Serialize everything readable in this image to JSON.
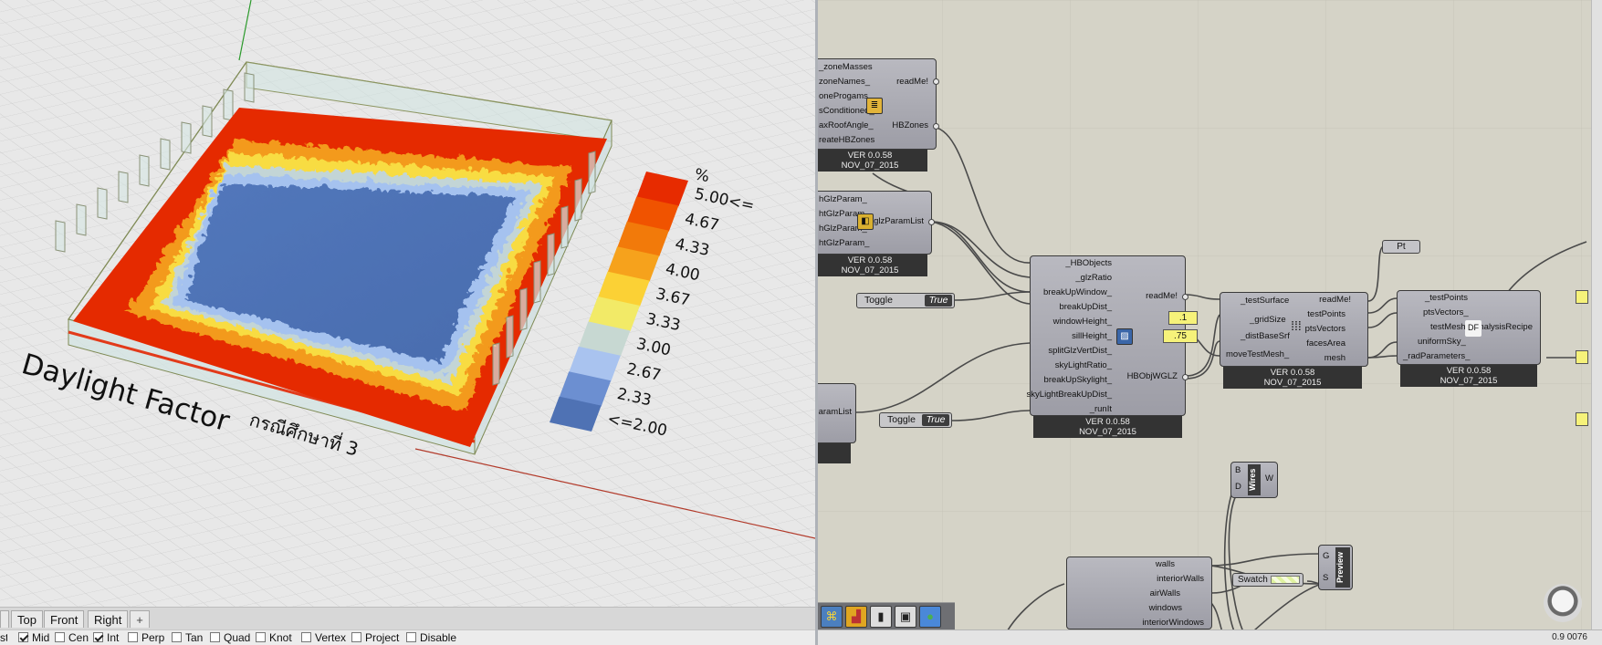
{
  "viewport": {
    "title_text": "Daylight Factor",
    "subtitle_thai": "กรณีศึกษาที่ 3",
    "legend": {
      "unit": "%",
      "labels": [
        "5.00<=",
        "4.67",
        "4.33",
        "4.00",
        "3.67",
        "3.33",
        "3.00",
        "2.67",
        "2.33",
        "<=2.00"
      ],
      "colors": [
        "#e72b00",
        "#f05300",
        "#f27a0a",
        "#f6a21c",
        "#fbd135",
        "#f2ea67",
        "#c7d8d2",
        "#a9c3ef",
        "#6c8fd1",
        "#4f72b4"
      ]
    },
    "tabs": [
      "Top",
      "Front",
      "Right"
    ],
    "add_tab_icon": "plus-icon",
    "osnaps": [
      {
        "label": "Mid",
        "checked": true
      },
      {
        "label": "Cen",
        "checked": false
      },
      {
        "label": "Int",
        "checked": true
      },
      {
        "label": "Perp",
        "checked": false
      },
      {
        "label": "Tan",
        "checked": false
      },
      {
        "label": "Quad",
        "checked": false
      },
      {
        "label": "Knot",
        "checked": false
      },
      {
        "label": "Vertex",
        "checked": false
      },
      {
        "label": "Project",
        "checked": false
      },
      {
        "label": "Disable",
        "checked": false
      }
    ]
  },
  "gh": {
    "zones": {
      "inputs": [
        "_zoneMasses",
        "zoneNames_",
        "oneProgams_",
        "sConditioned_",
        "axRoofAngle_",
        "reateHBZones"
      ],
      "outputs": [
        "readMe!",
        "HBZones"
      ],
      "version": "VER 0.0.58",
      "date": "NOV_07_2015"
    },
    "glz": {
      "inputs": [
        "hGlzParam_",
        "htGlzParam_",
        "hGlzParam_",
        "htGlzParam_"
      ],
      "output": "glzParamList",
      "version": "VER 0.0.58",
      "date": "NOV_07_2015"
    },
    "glz_partial": {
      "label": "aramList"
    },
    "hb": {
      "inputs": [
        "_HBObjects",
        "_glzRatio",
        "breakUpWindow_",
        "breakUpDist_",
        "windowHeight_",
        "sillHeight_",
        "splitGlzVertDist_",
        "skyLightRatio_",
        "breakUpSkylight_",
        "skyLightBreakUpDist_",
        "_runIt"
      ],
      "outputs": [
        "readMe!",
        "HBObjWGLZ"
      ],
      "version": "VER 0.0.58",
      "date": "NOV_07_2015"
    },
    "toggle1": {
      "label": "Toggle",
      "value": "True"
    },
    "toggle2": {
      "label": "Toggle",
      "value": "True"
    },
    "num1": ".1",
    "num2": ".75",
    "grid": {
      "inputs": [
        "_testSurface",
        "_gridSize",
        "_distBaseSrf",
        "moveTestMesh_"
      ],
      "outputs": [
        "readMe!",
        "testPoints",
        "ptsVectors",
        "facesArea",
        "mesh"
      ],
      "version": "VER 0.0.58",
      "date": "NOV_07_2015"
    },
    "pt": "Pt",
    "recipe": {
      "inputs": [
        "_testPoints",
        "ptsVectors_",
        "testMesh_",
        "uniformSky_",
        "_radParameters_"
      ],
      "output": "analysisRecipe",
      "version": "VER 0.0.58",
      "date": "NOV_07_2015"
    },
    "wires": {
      "in1": "B",
      "in2": "D",
      "label": "Wires",
      "out": "W"
    },
    "swatch": {
      "label": "Swatch"
    },
    "preview": {
      "in1": "G",
      "in2": "S",
      "label": "Preview"
    },
    "decompose": {
      "outputs": [
        "walls",
        "interiorWalls",
        "airWalls",
        "windows",
        "interiorWindows"
      ]
    },
    "toolbar_icons": [
      "python-icon",
      "chart-icon",
      "battery-icon",
      "box-icon",
      "sphere-icon"
    ],
    "status": "0.9 0076"
  }
}
